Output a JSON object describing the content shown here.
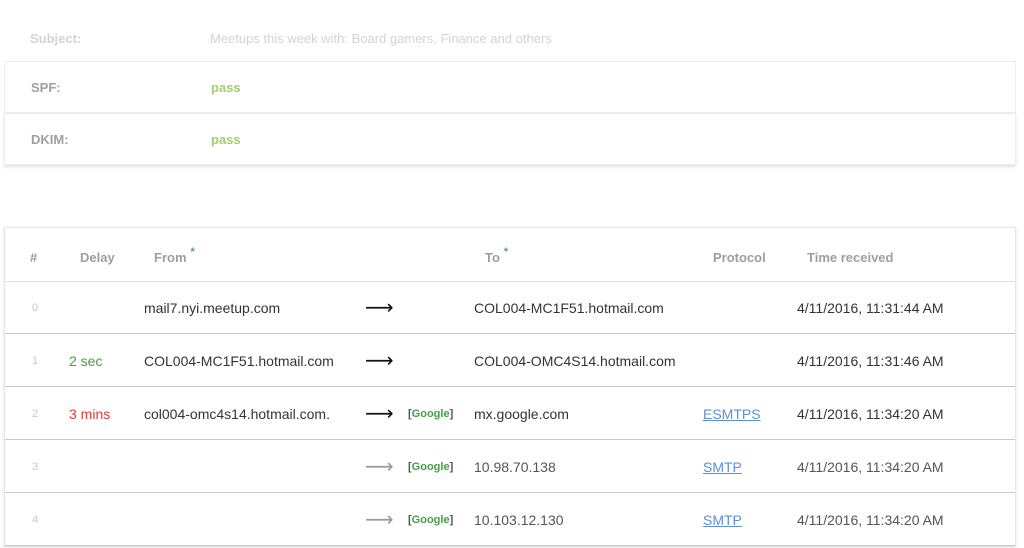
{
  "info": {
    "subject": {
      "label": "Subject:",
      "value": "Meetups this week with: Board gamers, Finance and others"
    },
    "spf": {
      "label": "SPF:",
      "value": "pass"
    },
    "dkim": {
      "label": "DKIM:",
      "value": "pass"
    }
  },
  "hops": {
    "headers": {
      "index": "#",
      "delay": "Delay",
      "from": "From",
      "from_star": "*",
      "to": "To",
      "to_star": "*",
      "protocol": "Protocol",
      "time": "Time received"
    },
    "arrow_glyph": "⟶",
    "badge_open": "[",
    "badge_name": "Google",
    "badge_close": "]",
    "rows": [
      {
        "index": "0",
        "delay": "",
        "from": "mail7.nyi.meetup.com",
        "to": "COL004-MC1F51.hotmail.com",
        "protocol": "",
        "time": "4/11/2016, 11:31:44 AM"
      },
      {
        "index": "1",
        "delay": "2 sec",
        "from": "COL004-MC1F51.hotmail.com",
        "to": "COL004-OMC4S14.hotmail.com",
        "protocol": "",
        "time": "4/11/2016, 11:31:46 AM"
      },
      {
        "index": "2",
        "delay": "3 mins",
        "from": "col004-omc4s14.hotmail.com.",
        "to": "mx.google.com",
        "protocol": "ESMTPS",
        "time": "4/11/2016, 11:34:20 AM"
      },
      {
        "index": "3",
        "delay": "",
        "from": "",
        "to": "10.98.70.138",
        "protocol": "SMTP",
        "time": "4/11/2016, 11:34:20 AM"
      },
      {
        "index": "4",
        "delay": "",
        "from": "",
        "to": "10.103.12.130",
        "protocol": "SMTP",
        "time": "4/11/2016, 11:34:20 AM"
      }
    ]
  },
  "colors": {
    "pass": "#8bc34a",
    "delay_short": "#43a047",
    "delay_long": "#e53935",
    "google_badge": "#43a047",
    "protocol_link": "#5c8fd6"
  }
}
